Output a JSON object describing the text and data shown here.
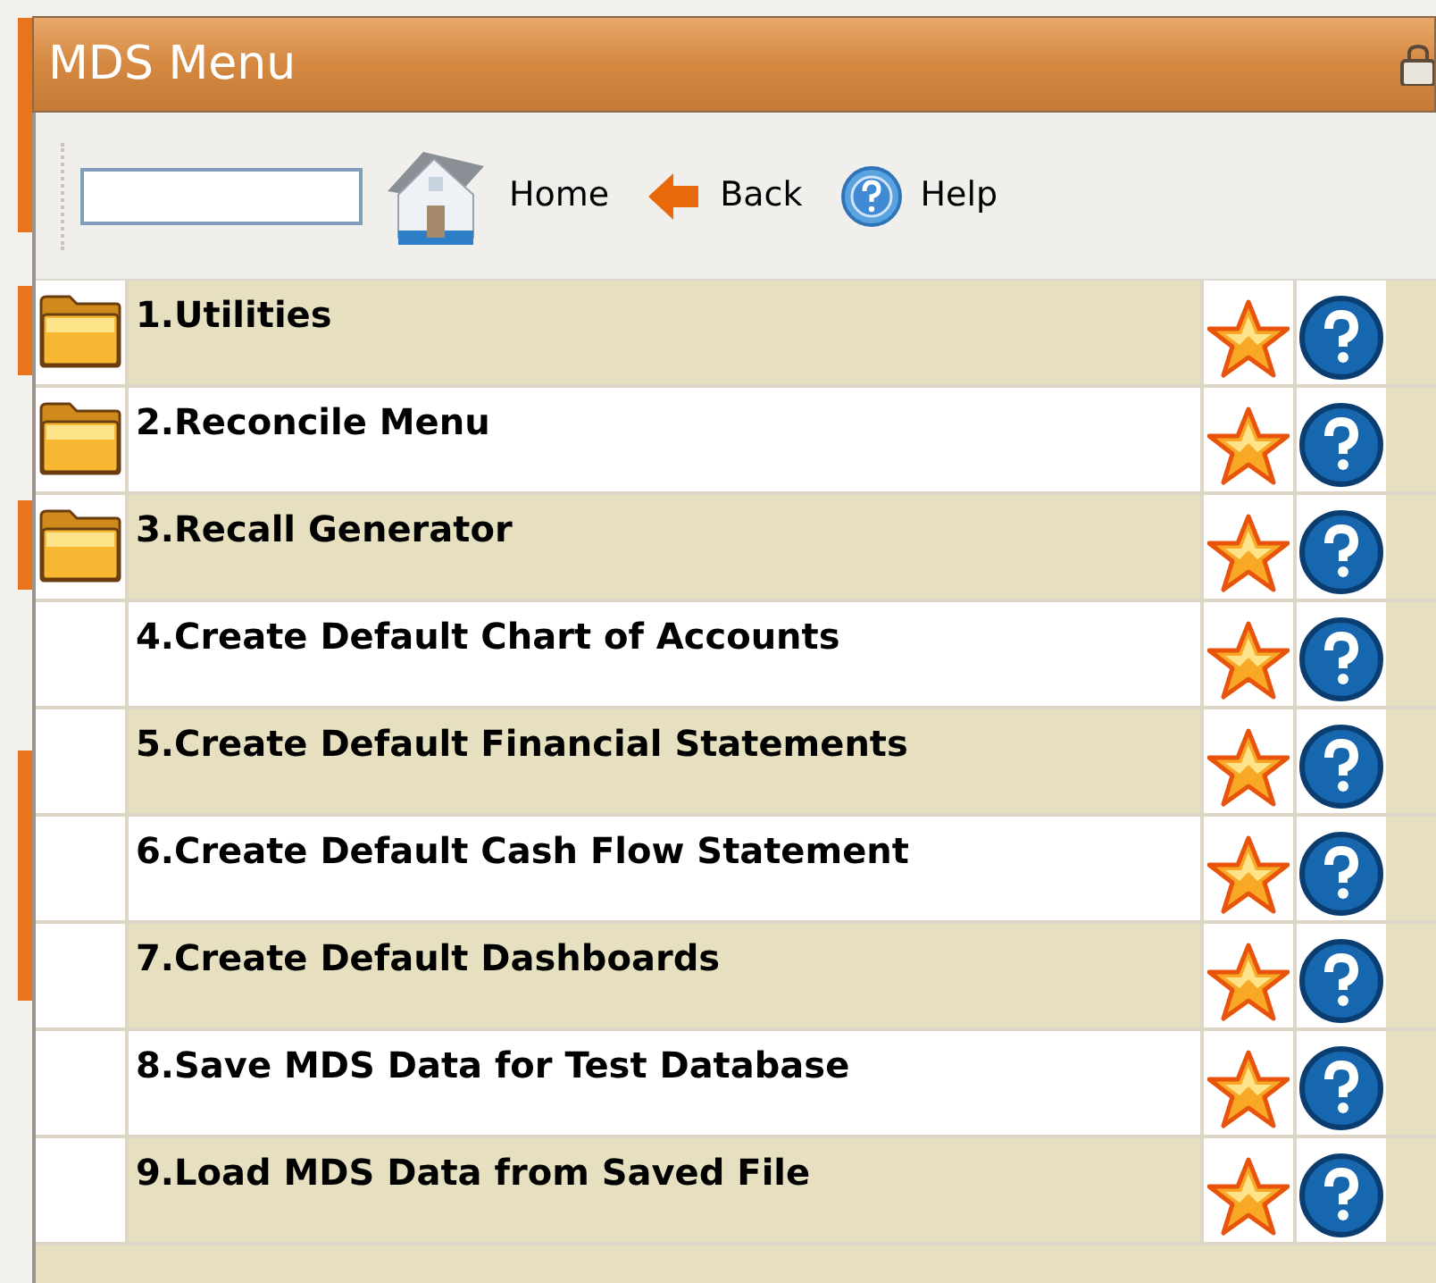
{
  "window": {
    "title": "MDS Menu"
  },
  "toolbar": {
    "buttons": [
      {
        "kind": "home",
        "label": "Home"
      },
      {
        "kind": "back",
        "label": "Back"
      },
      {
        "kind": "help",
        "label": "Help"
      }
    ]
  },
  "menu": {
    "items": [
      {
        "kind": "folder",
        "label": "1.Utilities"
      },
      {
        "kind": "folder",
        "label": "2.Reconcile Menu"
      },
      {
        "kind": "folder",
        "label": "3.Recall Generator"
      },
      {
        "kind": "item",
        "label": "4.Create Default Chart of Accounts"
      },
      {
        "kind": "item",
        "label": "5.Create Default Financial Statements"
      },
      {
        "kind": "item",
        "label": "6.Create Default Cash Flow Statement"
      },
      {
        "kind": "item",
        "label": "7.Create Default Dashboards"
      },
      {
        "kind": "item",
        "label": "8.Save MDS Data for Test Database"
      },
      {
        "kind": "item",
        "label": "9.Load MDS Data from Saved File"
      }
    ]
  }
}
